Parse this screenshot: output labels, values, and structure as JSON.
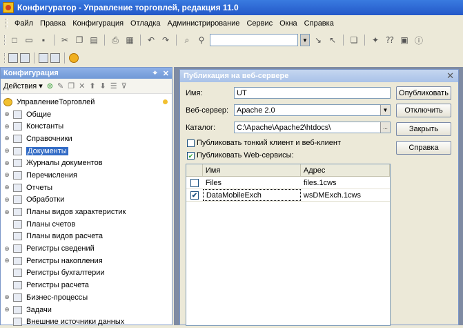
{
  "window": {
    "title": "Конфигуратор - Управление торговлей, редакция 11.0"
  },
  "menu": [
    {
      "key": "file",
      "label": "Файл"
    },
    {
      "key": "edit",
      "label": "Правка"
    },
    {
      "key": "config",
      "label": "Конфигурация"
    },
    {
      "key": "debug",
      "label": "Отладка"
    },
    {
      "key": "admin",
      "label": "Администрирование"
    },
    {
      "key": "service",
      "label": "Сервис"
    },
    {
      "key": "windows",
      "label": "Окна"
    },
    {
      "key": "help",
      "label": "Справка"
    }
  ],
  "config_panel": {
    "title": "Конфигурация",
    "actions_label": "Действия",
    "tree": [
      {
        "label": "УправлениеТорговлей",
        "root": true
      },
      {
        "label": "Общие"
      },
      {
        "label": "Константы"
      },
      {
        "label": "Справочники"
      },
      {
        "label": "Документы",
        "selected": true
      },
      {
        "label": "Журналы документов"
      },
      {
        "label": "Перечисления"
      },
      {
        "label": "Отчеты"
      },
      {
        "label": "Обработки"
      },
      {
        "label": "Планы видов характеристик"
      },
      {
        "label": "Планы счетов"
      },
      {
        "label": "Планы видов расчета"
      },
      {
        "label": "Регистры сведений"
      },
      {
        "label": "Регистры накопления"
      },
      {
        "label": "Регистры бухгалтерии"
      },
      {
        "label": "Регистры расчета"
      },
      {
        "label": "Бизнес-процессы"
      },
      {
        "label": "Задачи"
      },
      {
        "label": "Внешние источники данных"
      }
    ]
  },
  "dialog": {
    "title": "Публикация на веб-сервере",
    "name_label": "Имя:",
    "name_value": "UT",
    "server_label": "Веб-сервер:",
    "server_value": "Apache 2.0",
    "catalog_label": "Каталог:",
    "catalog_value": "C:\\Apache\\Apache2\\htdocs\\",
    "browse_label": "...",
    "thin_client_label": "Публиковать тонкий клиент и веб-клиент",
    "web_services_label": "Публиковать Web-сервисы:",
    "buttons": {
      "publish": "Опубликовать",
      "disable": "Отключить",
      "close": "Закрыть",
      "help": "Справка"
    },
    "table": {
      "col_name": "Имя",
      "col_address": "Адрес",
      "rows": [
        {
          "checked": false,
          "name": "Files",
          "address": "files.1cws"
        },
        {
          "checked": true,
          "name": "DataMobileExch",
          "address": "wsDMExch.1cws"
        }
      ]
    }
  }
}
